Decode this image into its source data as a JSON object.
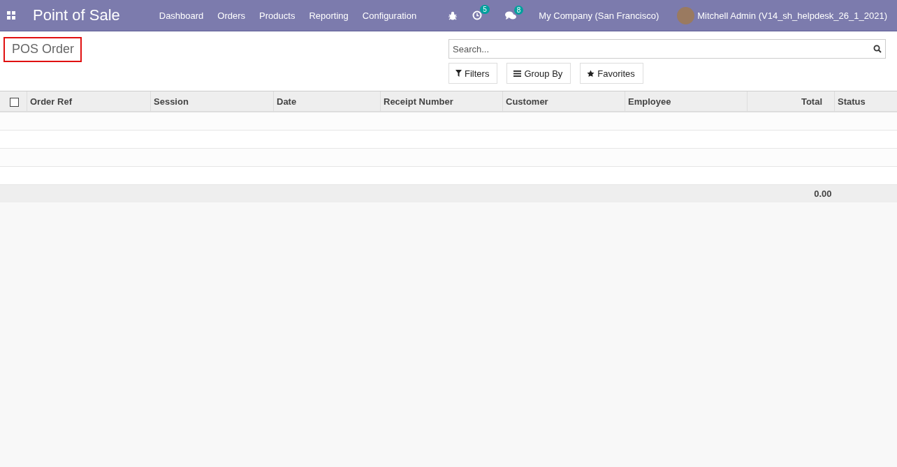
{
  "navbar": {
    "app_title": "Point of Sale",
    "menu": [
      "Dashboard",
      "Orders",
      "Products",
      "Reporting",
      "Configuration"
    ],
    "activity_count": "5",
    "message_count": "8",
    "company": "My Company (San Francisco)",
    "user": "Mitchell Admin (V14_sh_helpdesk_26_1_2021)"
  },
  "control_panel": {
    "breadcrumb": "POS Order",
    "breadcrumb_highlighted": true,
    "search": {
      "placeholder": "Search..."
    },
    "buttons": [
      {
        "kind": "filter",
        "label": "Filters"
      },
      {
        "kind": "group",
        "label": "Group By"
      },
      {
        "kind": "favorite",
        "label": "Favorites"
      }
    ]
  },
  "table": {
    "select_all_checked": false,
    "columns": [
      {
        "label": "Order Ref",
        "kind": "text"
      },
      {
        "label": "Session",
        "kind": "text"
      },
      {
        "label": "Date",
        "kind": "text"
      },
      {
        "label": "Receipt Number",
        "kind": "text"
      },
      {
        "label": "Customer",
        "kind": "text"
      },
      {
        "label": "Employee",
        "kind": "text"
      },
      {
        "label": "Total",
        "kind": "number"
      },
      {
        "label": "Status",
        "kind": "text"
      }
    ],
    "footer": {
      "total": "0.00"
    }
  }
}
